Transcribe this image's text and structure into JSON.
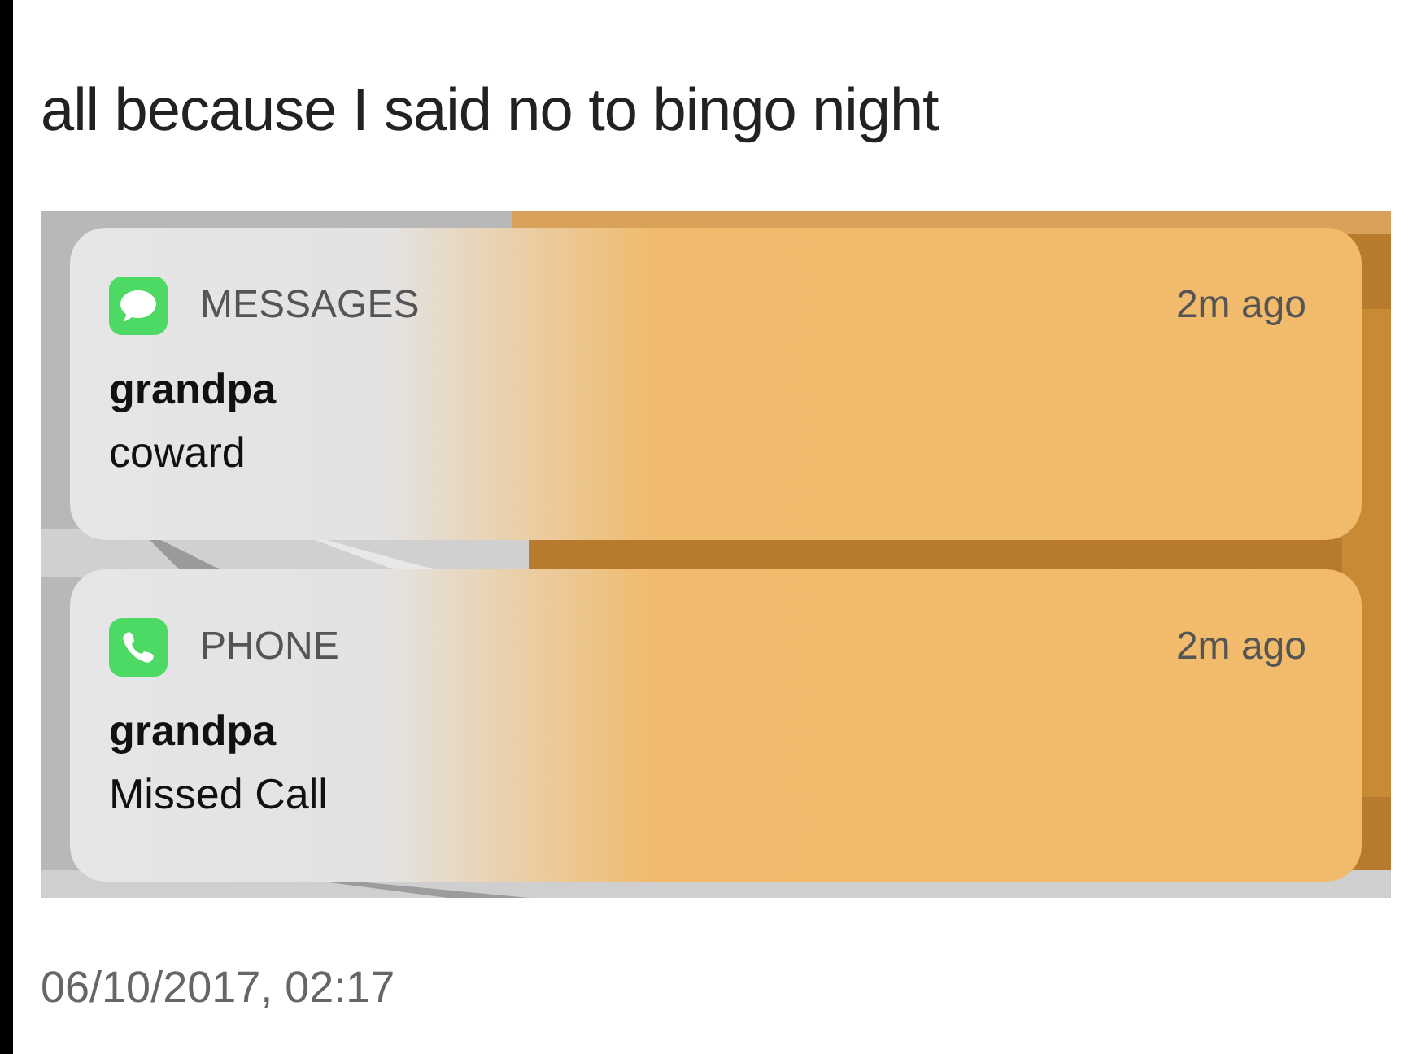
{
  "post": {
    "text": "all because I said no to bingo night",
    "timestamp": "06/10/2017, 02:17"
  },
  "screenshot": {
    "kind": "picture",
    "notifications": [
      {
        "kind": "messages",
        "app": "MESSAGES",
        "time": "2m ago",
        "sender": "grandpa",
        "body": "coward"
      },
      {
        "kind": "phone",
        "app": "PHONE",
        "time": "2m ago",
        "sender": "grandpa",
        "body": "Missed Call"
      }
    ]
  }
}
